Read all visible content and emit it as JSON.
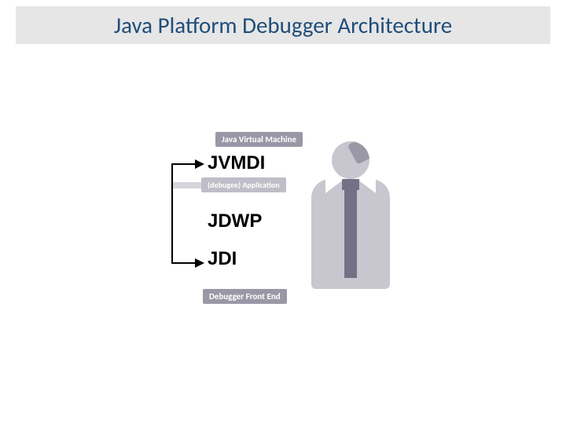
{
  "title": "Java Platform Debugger Architecture",
  "diagram": {
    "top_label": "Java Virtual Machine",
    "mid_label": "(debugee) Application",
    "bottom_label": "Debugger Front End",
    "api_layers": {
      "jvmdi": "JVMDI",
      "jdwp": "JDWP",
      "jdi": "JDI"
    }
  }
}
